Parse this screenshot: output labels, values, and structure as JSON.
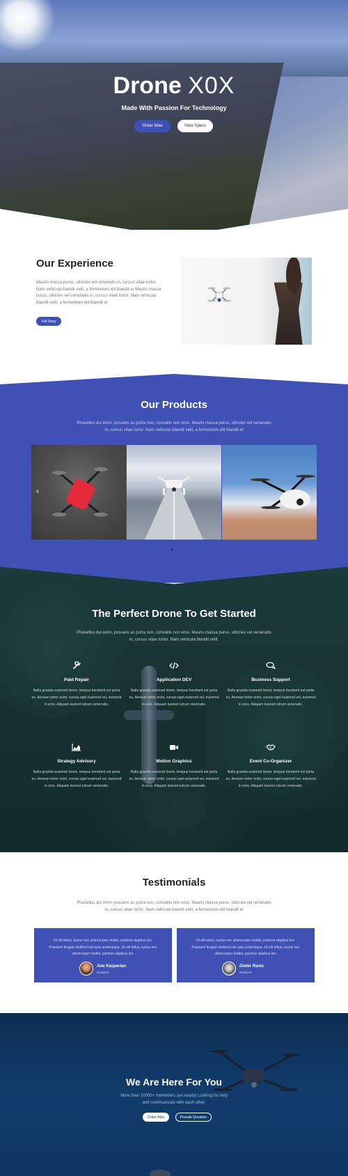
{
  "hero": {
    "title_bold": "Drone",
    "title_light": "X0X",
    "subtitle": "Made With Passion For Technology",
    "order_button": "Order Now",
    "specs_button": "View Specs"
  },
  "experience": {
    "title": "Our Experience",
    "text": "Mauris massa purus, ultricies vel venenatis in, cursus vitae tortor. Nam vehicula blandit velit, a fermentum elit blandit et Mauris massa purus, ultricies vel venenatis in, cursus vitae tortor. Nam vehicula blandit velit, a fermentum elit blandit et",
    "button": "Full Story"
  },
  "products": {
    "title": "Our Products",
    "text": "Phasellus dui enim, posuere ac porta non, convallis non eros. Mauris massa purus, ultricies vel venenatis in, cursus vitae tortor. Nam vehicula blandit velit, a fermentum elit blandit et",
    "prev_icon": "chevron-left-icon"
  },
  "features": {
    "title": "The Perfect Drone To Get Started",
    "text": "Phasellus dui enim, posuere ac porta non, convallis non eros. Mauris massa purus, ultricies vel venenatis in, cursus vitae tortor. Nam vehicula blandit velit.",
    "items": [
      {
        "icon": "wrench-icon",
        "title": "Paid Repair",
        "desc": "Nulla gravida euismod lorem, tempus hendrerit est porta eu. Aenean tortor enim, cursus eget euismod vel, euismod in eros. Aliquam laoreet rutrum venenatis."
      },
      {
        "icon": "code-icon",
        "title": "Application DEV",
        "desc": "Nulla gravida euismod lorem, tempus hendrerit est porta eu. Aenean tortor enim, cursus eget euismod vel, euismod in eros. Aliquam laoreet rutrum venenatis."
      },
      {
        "icon": "chat-icon",
        "title": "Business Support",
        "desc": "Nulla gravida euismod lorem, tempus hendrerit est porta eu. Aenean tortor enim, cursus eget euismod vel, euismod in eros. Aliquam laoreet rutrum venenatis."
      },
      {
        "icon": "area-chart-icon",
        "title": "Strategy Advisory",
        "desc": "Nulla gravida euismod lorem, tempus hendrerit est porta eu. Aenean tortor enim, cursus eget euismod vel, euismod in eros. Aliquam laoreet rutrum venenatis."
      },
      {
        "icon": "video-camera-icon",
        "title": "Motion Graphics",
        "desc": "Nulla gravida euismod lorem, tempus hendrerit est porta eu. Aenean tortor enim, cursus eget euismod vel, euismod in eros. Aliquam laoreet rutrum venenatis."
      },
      {
        "icon": "handshake-icon",
        "title": "Event Co-Organizer",
        "desc": "Nulla gravida euismod lorem, tempus hendrerit est porta eu. Aenean tortor enim, cursus eget euismod vel, euismod in eros. Aliquam laoreet rutrum venenatis."
      }
    ]
  },
  "testimonials": {
    "title": "Testimonials",
    "text": "Phasellus dui enim, posuere ac porta non, convallis non eros. Mauris massa purus, ultricies vel venenatis in, cursus vitae tortor. Nam vehicula blandit velit, a fermentum elit blandit et",
    "items": [
      {
        "quote": "Ut elit tellus, luctus nec ullamcorper mattis, pulvinar dapibus leo. Praesent feugiat eleifend nisi quis scelerisque. Ut elit tellus, luctus nec ullamcorper mattis, pulvinar dapibus leo.",
        "name": "Ana Kasperian",
        "role": "Designer"
      },
      {
        "quote": "Ut elit tellus, luctus nec ullamcorper mattis, pulvinar dapibus leo. Praesent feugiat eleifend nisi quis scelerisque. Ut elit tellus, luctus nec ullamcorper mattis, pulvinar dapibus leo.",
        "name": "Dieter Rams",
        "role": "Designer"
      }
    ]
  },
  "contact": {
    "title": "We Are Here For You",
    "text": "More than 10000+ memebers are nearby Looking for help and communicate with each other.",
    "order_button": "Order Now",
    "question_button": "Presale Question"
  },
  "colors": {
    "accent": "#3f51b5",
    "forest": "#163230",
    "navy": "#0f3563"
  }
}
